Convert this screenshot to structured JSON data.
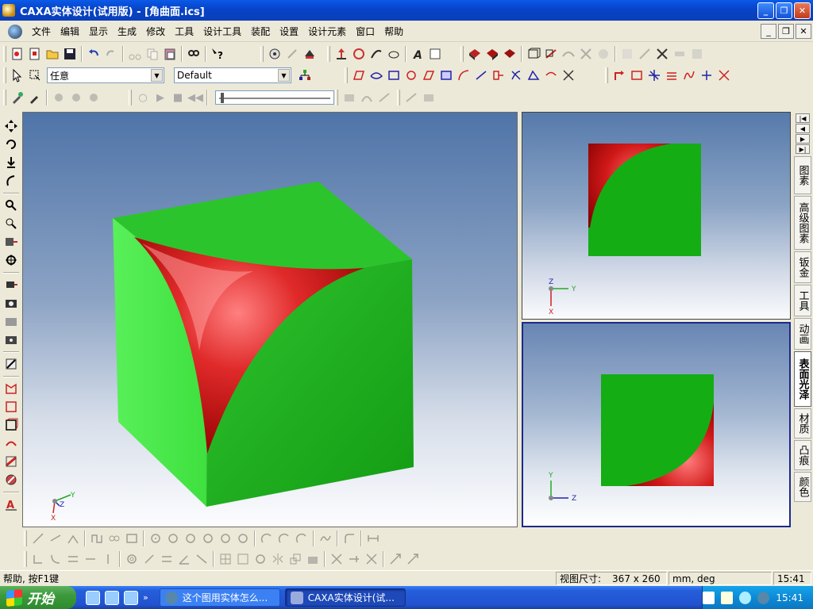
{
  "window": {
    "title": "CAXA实体设计(试用版) - [角曲面.ics]",
    "buttons": {
      "minimize": "_",
      "restore": "❐",
      "close": "✕"
    }
  },
  "menu": {
    "items": [
      "文件",
      "编辑",
      "显示",
      "生成",
      "修改",
      "工具",
      "设计工具",
      "装配",
      "设置",
      "设计元素",
      "窗口",
      "帮助"
    ]
  },
  "toolbar2": {
    "filter_value": "任意",
    "style_value": "Default"
  },
  "viewports": {
    "main": {
      "axis_labels": [
        "Y",
        "Z",
        "X"
      ]
    },
    "top": {
      "axis_labels": [
        "Z",
        "Y",
        "X"
      ]
    },
    "front": {
      "axis_labels": [
        "Y",
        "Z"
      ]
    }
  },
  "colors": {
    "cube_green": "#16b516",
    "fillet_red": "#c81010",
    "active_frame": "#1b2a8a"
  },
  "right_tabs": {
    "items": [
      "图素",
      "高级图素",
      "钣金",
      "工具",
      "动画",
      "表面光泽",
      "材质",
      "凸痕",
      "颜色"
    ],
    "active": "表面光泽"
  },
  "status": {
    "help": "帮助, 按F1键",
    "view_size_label": "视图尺寸:",
    "view_size_value": "367 x 260",
    "units": "mm, deg",
    "time": "15:41"
  },
  "taskbar": {
    "start": "开始",
    "task1": "这个图用实体怎么...",
    "task2": "CAXA实体设计(试...",
    "clock": "15:41"
  }
}
